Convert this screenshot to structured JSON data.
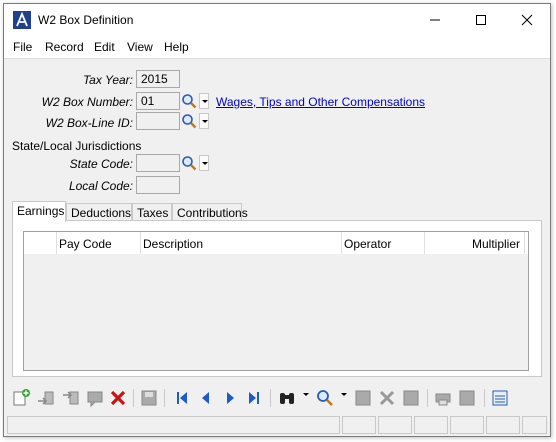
{
  "window": {
    "title": "W2 Box Definition"
  },
  "menu": {
    "items": [
      "File",
      "Record",
      "Edit",
      "View",
      "Help"
    ]
  },
  "form": {
    "tax_year_label": "Tax Year:",
    "tax_year_value": "2015",
    "box_number_label": "W2 Box Number:",
    "box_number_value": "01",
    "box_description_link": "Wages, Tips and Other Compensations",
    "box_line_label": "W2  Box-Line ID:",
    "box_line_value": "",
    "state_local_heading": "State/Local Jurisdictions",
    "state_code_label": "State Code:",
    "state_code_value": "",
    "local_code_label": "Local Code:",
    "local_code_value": ""
  },
  "tabs": [
    "Earnings",
    "Deductions",
    "Taxes",
    "Contributions"
  ],
  "grid": {
    "columns": [
      "Pay Code",
      "Description",
      "Operator",
      "Multiplier"
    ],
    "rows": []
  },
  "toolbar": {
    "icons": [
      "new-record-icon",
      "insert-icon",
      "insert-before-icon",
      "comment-icon",
      "delete-icon",
      "save-icon",
      "first-record-icon",
      "previous-record-icon",
      "next-record-icon",
      "last-record-icon",
      "find-icon",
      "lookup-icon",
      "grid-icon",
      "tools-icon",
      "view-icon",
      "print-icon",
      "export-icon",
      "settings-icon"
    ]
  },
  "colors": {
    "window_bg": "#f0f0f0",
    "link": "#0000cc",
    "delete": "#cc1111",
    "nav_blue": "#1e5bc6"
  }
}
